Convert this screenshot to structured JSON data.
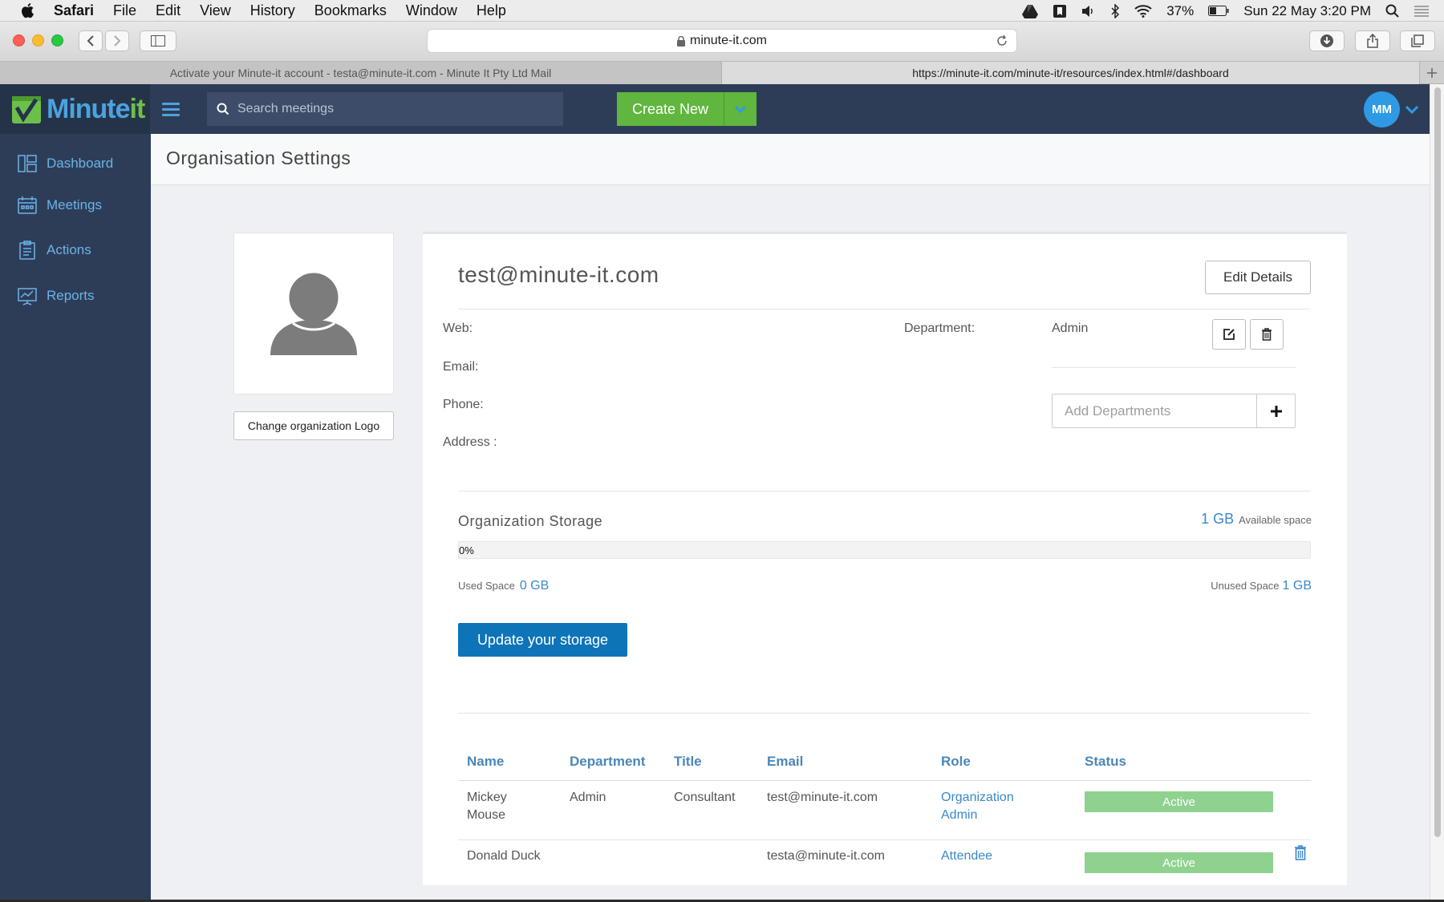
{
  "menubar": {
    "app": "Safari",
    "items": [
      "File",
      "Edit",
      "View",
      "History",
      "Bookmarks",
      "Window",
      "Help"
    ],
    "battery": "37%",
    "clock": "Sun 22 May  3:20 PM"
  },
  "browser": {
    "url": "minute-it.com",
    "tabs": [
      "Activate your Minute-it account - testa@minute-it.com - Minute It Pty Ltd Mail",
      "https://minute-it.com/minute-it/resources/index.html#/dashboard"
    ]
  },
  "header": {
    "logo_main": "Minute",
    "logo_accent": "it",
    "search_placeholder": "Search meetings",
    "create_label": "Create New",
    "avatar_initials": "MM"
  },
  "sidebar": {
    "items": [
      {
        "label": "Dashboard",
        "icon": "dashboard-icon"
      },
      {
        "label": "Meetings",
        "icon": "calendar-icon"
      },
      {
        "label": "Actions",
        "icon": "clipboard-icon"
      },
      {
        "label": "Reports",
        "icon": "chart-icon"
      }
    ]
  },
  "page": {
    "title": "Organisation Settings",
    "change_logo_label": "Change organization Logo"
  },
  "org": {
    "email": "test@minute-it.com",
    "edit_label": "Edit Details",
    "web_label": "Web:",
    "email_label": "Email:",
    "phone_label": "Phone:",
    "address_label": "Address :",
    "department_label": "Department:",
    "department_value": "Admin",
    "add_dept_placeholder": "Add Departments"
  },
  "storage": {
    "title": "Organization Storage",
    "available_value": "1 GB",
    "available_label": "Available space",
    "used_percent": 0,
    "progress_text": "0%",
    "used_label": "Used Space",
    "used_value": "0  GB",
    "unused_label": "Unused Space",
    "unused_value": "1 GB",
    "update_label": "Update your storage"
  },
  "members": {
    "headers": [
      "Name",
      "Department",
      "Title",
      "Email",
      "Role",
      "Status"
    ],
    "rows": [
      {
        "name_line1": "Mickey",
        "name_line2": "Mouse",
        "department": "Admin",
        "title": "Consultant",
        "email": "test@minute-it.com",
        "role_line1": "Organization",
        "role_line2": "Admin",
        "status": "Active"
      },
      {
        "name_line1": "Donald Duck",
        "name_line2": "",
        "department": "",
        "title": "",
        "email": "testa@minute-it.com",
        "role_line1": "Attendee",
        "role_line2": "",
        "status": "Active"
      }
    ]
  },
  "colors": {
    "nav_bg": "#2e3d57",
    "accent_blue": "#3a89c9",
    "create_green": "#60b63e",
    "active_green": "#8fd18f",
    "primary_button": "#0d74b8"
  }
}
